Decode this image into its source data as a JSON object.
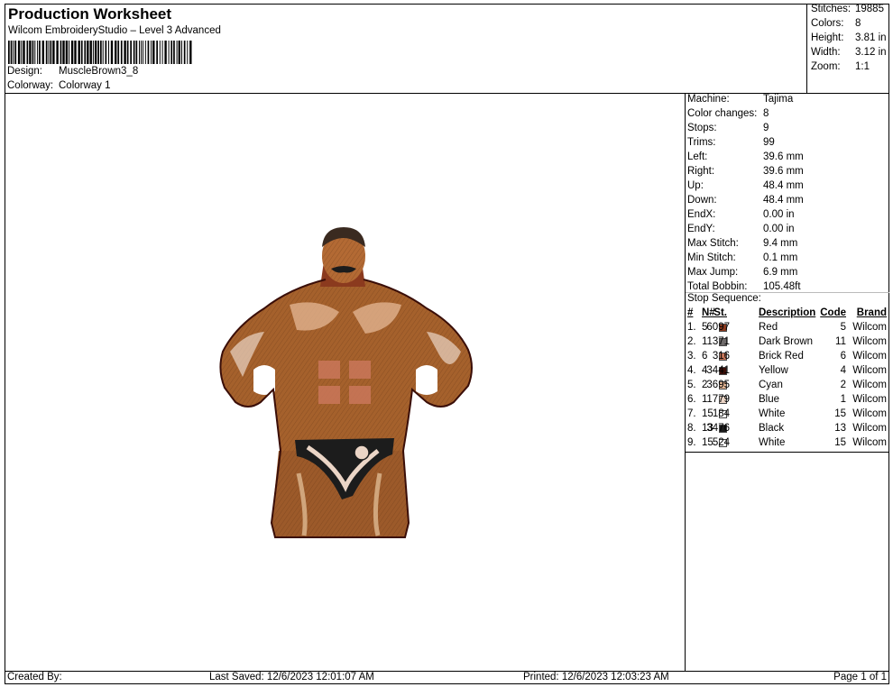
{
  "header": {
    "title": "Production Worksheet",
    "subtitle": "Wilcom EmbroideryStudio – Level 3 Advanced",
    "design_label": "Design:",
    "design_value": "MuscleBrown3_8",
    "colorway_label": "Colorway:",
    "colorway_value": "Colorway 1"
  },
  "summary": [
    {
      "label": "Stitches:",
      "value": "19885"
    },
    {
      "label": "Colors:",
      "value": "8"
    },
    {
      "label": "Height:",
      "value": "3.81 in"
    },
    {
      "label": "Width:",
      "value": "3.12 in"
    },
    {
      "label": "Zoom:",
      "value": "1:1"
    }
  ],
  "stats": [
    {
      "label": "Machine:",
      "value": "Tajima"
    },
    {
      "label": "Color changes:",
      "value": "8"
    },
    {
      "label": "Stops:",
      "value": "9"
    },
    {
      "label": "Trims:",
      "value": "99"
    },
    {
      "label": "Left:",
      "value": "39.6 mm"
    },
    {
      "label": "Right:",
      "value": "39.6 mm"
    },
    {
      "label": "Up:",
      "value": "48.4 mm"
    },
    {
      "label": "Down:",
      "value": "48.4 mm"
    },
    {
      "label": "EndX:",
      "value": "0.00 in"
    },
    {
      "label": "EndY:",
      "value": "0.00 in"
    },
    {
      "label": "Max Stitch:",
      "value": "9.4 mm"
    },
    {
      "label": "Min Stitch:",
      "value": "0.1 mm"
    },
    {
      "label": "Max Jump:",
      "value": "6.9 mm"
    },
    {
      "label": "Total Bobbin:",
      "value": "105.48ft"
    }
  ],
  "stop_sequence": {
    "title": "Stop Sequence:",
    "headers": {
      "idx": "#",
      "num": "N#",
      "st": "St.",
      "desc": "Description",
      "code": "Code",
      "brand": "Brand"
    },
    "rows": [
      {
        "idx": "1.",
        "num": "5",
        "color": "#8b3a1e",
        "st": "6097",
        "desc": "Red",
        "code": "5",
        "brand": "Wilcom"
      },
      {
        "idx": "2.",
        "num": "11",
        "color": "#6e6a6a",
        "st": "371",
        "desc": "Dark Brown",
        "code": "11",
        "brand": "Wilcom"
      },
      {
        "idx": "3.",
        "num": "6",
        "color": "#c9775a",
        "st": "316",
        "desc": "Brick Red",
        "code": "6",
        "brand": "Wilcom"
      },
      {
        "idx": "4.",
        "num": "4",
        "color": "#3a0e08",
        "st": "3441",
        "desc": "Yellow",
        "code": "4",
        "brand": "Wilcom"
      },
      {
        "idx": "5.",
        "num": "2",
        "color": "#e6b896",
        "st": "3695",
        "desc": "Cyan",
        "code": "2",
        "brand": "Wilcom"
      },
      {
        "idx": "6.",
        "num": "1",
        "color": "#ebd5c6",
        "st": "1779",
        "desc": "Blue",
        "code": "1",
        "brand": "Wilcom"
      },
      {
        "idx": "7.",
        "num": "15",
        "color": "#ffffff",
        "st": "184",
        "desc": "White",
        "code": "15",
        "brand": "Wilcom"
      },
      {
        "idx": "8.",
        "num": "13",
        "color": "#1c1c1c",
        "st": "3476",
        "desc": "Black",
        "code": "13",
        "brand": "Wilcom"
      },
      {
        "idx": "9.",
        "num": "15",
        "color": "#ffffff",
        "st": "524",
        "desc": "White",
        "code": "15",
        "brand": "Wilcom"
      }
    ]
  },
  "footer": {
    "created_by": "Created By:",
    "last_saved": "Last Saved: 12/6/2023 12:01:07 AM",
    "printed": "Printed: 12/6/2023 12:03:23 AM",
    "page": "Page 1 of 1"
  }
}
